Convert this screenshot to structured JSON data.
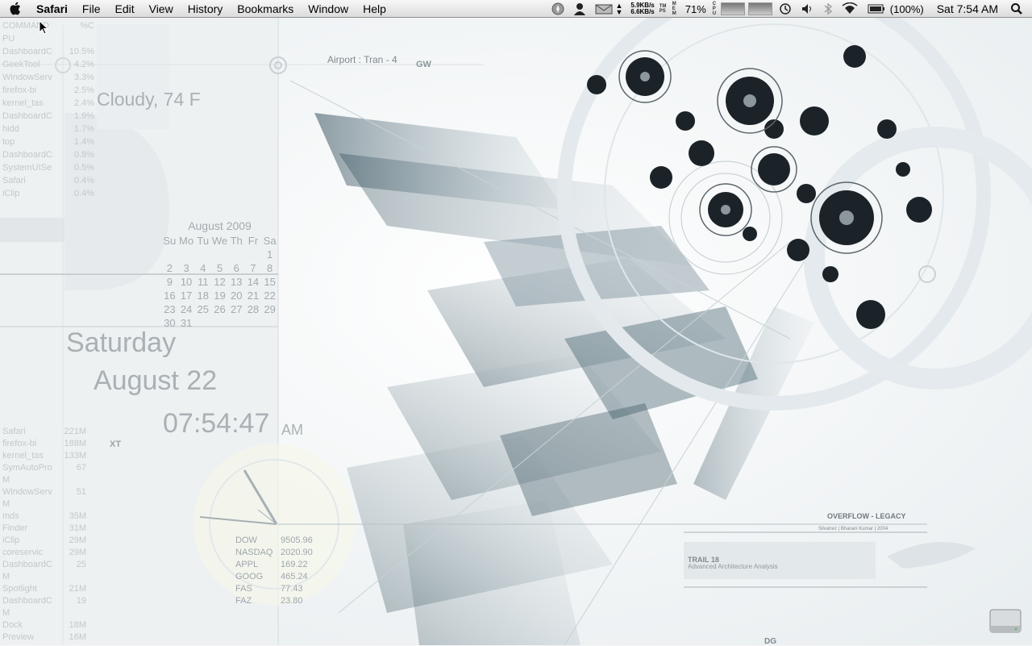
{
  "menubar": {
    "app_name": "Safari",
    "menus": [
      "File",
      "Edit",
      "View",
      "History",
      "Bookmarks",
      "Window",
      "Help"
    ],
    "net_up": "5.9KB/s",
    "net_down": "6.6KB/s",
    "tm_label": "TM PS",
    "cpu_label": "CPU",
    "mem_label": "MEM",
    "cpu_percent": "71%",
    "battery": "(100%)",
    "clock": "Sat 7:54 AM",
    "icons": [
      "apple-icon",
      "compass-icon",
      "user-icon",
      "mail-icon",
      "time-machine-icon",
      "volume-icon",
      "bluetooth-icon",
      "wifi-icon",
      "battery-icon",
      "spotlight-icon"
    ]
  },
  "desktop": {
    "cpu_header": {
      "name": "COMMAND",
      "value": "%C"
    },
    "cpu_sub": "PU",
    "cpu_processes": [
      {
        "name": "DashboardC",
        "value": "10.5%"
      },
      {
        "name": "GeekTool",
        "value": "4.2%"
      },
      {
        "name": "WindowServ",
        "value": "3.3%"
      },
      {
        "name": "firefox-bi",
        "value": "2.5%"
      },
      {
        "name": "kernel_tas",
        "value": "2.4%"
      },
      {
        "name": "DashboardC",
        "value": "1.9%"
      },
      {
        "name": "hidd",
        "value": "1.7%"
      },
      {
        "name": "top",
        "value": "1.4%"
      },
      {
        "name": "DashboardC",
        "value": "0.8%"
      },
      {
        "name": "SystemUISe",
        "value": "0.5%"
      },
      {
        "name": "Safari",
        "value": "0.4%"
      },
      {
        "name": "iClip",
        "value": "0.4%"
      }
    ],
    "weather": "Cloudy, 74 F",
    "airport": "Airport : Tran - 4",
    "gw_label": "GW",
    "calendar": {
      "title": "August 2009",
      "days": [
        "Su",
        "Mo",
        "Tu",
        "We",
        "Th",
        "Fr",
        "Sa"
      ],
      "weeks": [
        [
          "",
          "",
          "",
          "",
          "",
          "",
          "1"
        ],
        [
          "2",
          "3",
          "4",
          "5",
          "6",
          "7",
          "8"
        ],
        [
          "9",
          "10",
          "11",
          "12",
          "13",
          "14",
          "15"
        ],
        [
          "16",
          "17",
          "18",
          "19",
          "20",
          "21",
          "22"
        ],
        [
          "23",
          "24",
          "25",
          "26",
          "27",
          "28",
          "29"
        ],
        [
          "30",
          "31",
          "",
          "",
          "",
          "",
          ""
        ]
      ]
    },
    "weekday": "Saturday",
    "date": "August 22",
    "time": "07:54:47",
    "ampm": "AM",
    "xt_label": "XT",
    "mem_processes": [
      {
        "name": "Safari",
        "value": "221M"
      },
      {
        "name": "firefox-bi",
        "value": "188M"
      },
      {
        "name": "kernel_tas",
        "value": "133M"
      },
      {
        "name": "SymAutoPro",
        "value": "67"
      },
      {
        "name": "M",
        "value": ""
      },
      {
        "name": "WindowServ",
        "value": "51"
      },
      {
        "name": "M",
        "value": ""
      },
      {
        "name": "mds",
        "value": "35M"
      },
      {
        "name": "Finder",
        "value": "31M"
      },
      {
        "name": "iClip",
        "value": "29M"
      },
      {
        "name": "coreservic",
        "value": "29M"
      },
      {
        "name": "DashboardC",
        "value": "25"
      },
      {
        "name": "M",
        "value": ""
      },
      {
        "name": "Spotlight",
        "value": "21M"
      },
      {
        "name": "DashboardC",
        "value": "19"
      },
      {
        "name": "M",
        "value": ""
      },
      {
        "name": "Dock",
        "value": "18M"
      },
      {
        "name": "Preview",
        "value": "16M"
      }
    ],
    "stocks": [
      {
        "name": "DOW",
        "value": "9505.96"
      },
      {
        "name": "NASDAQ",
        "value": "2020.90"
      },
      {
        "name": "APPL",
        "value": "169.22"
      },
      {
        "name": "GOOG",
        "value": "465.24"
      },
      {
        "name": "FAS",
        "value": "77.43"
      },
      {
        "name": "FAZ",
        "value": "23.80"
      }
    ],
    "overflow_title": "OVERFLOW - LEGACY",
    "overflow_credit": "Silvatrez | Bharani Kumar | 2004",
    "trail_title": "TRAIL 18",
    "trail_sub": "Advanced Architecture Analysis",
    "dg_label": "DG"
  }
}
